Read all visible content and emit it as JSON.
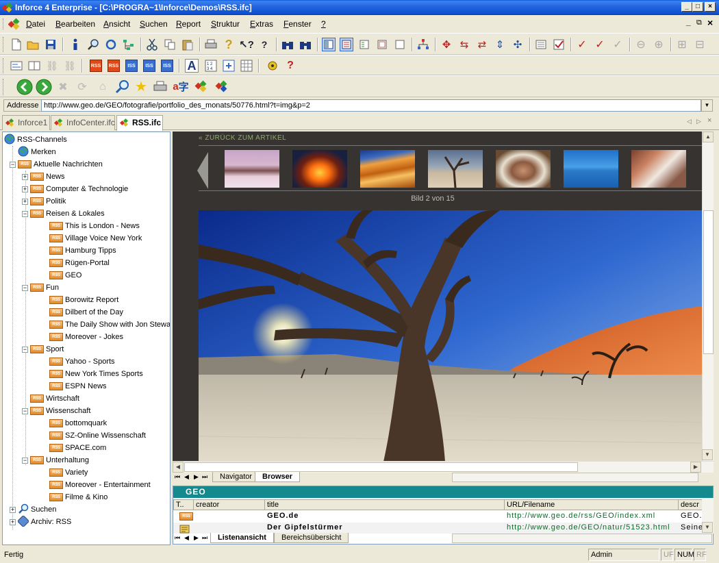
{
  "window": {
    "title": "Inforce 4 Enterprise - [C:\\PROGRA~1\\Inforce\\Demos\\RSS.ifc]",
    "min_glyph": "_",
    "max_glyph": "□",
    "close_glyph": "×",
    "mdi_min_glyph": "_",
    "mdi_restore_glyph": "⧉",
    "mdi_close_glyph": "×"
  },
  "menu": [
    "Datei",
    "Bearbeiten",
    "Ansicht",
    "Suchen",
    "Report",
    "Struktur",
    "Extras",
    "Fenster",
    "?"
  ],
  "address": {
    "label": "Addresse",
    "url": "http://www.geo.de/GEO/fotografie/portfolio_des_monats/50776.html?t=img&p=2"
  },
  "doc_tabs": [
    {
      "label": "Inforce1",
      "active": false
    },
    {
      "label": "InfoCenter.ifc",
      "active": false
    },
    {
      "label": "RSS.ifc",
      "active": true
    }
  ],
  "tree": {
    "root": "RSS-Channels",
    "items": [
      {
        "label": "Merken",
        "level": 1,
        "icon": "globe-icon"
      },
      {
        "label": "Aktuelle Nachrichten",
        "level": 1,
        "icon": "rss-folder-icon",
        "expanded": true
      },
      {
        "label": "News",
        "level": 2,
        "icon": "rss-folder-icon",
        "expanded": false
      },
      {
        "label": "Computer & Technologie",
        "level": 2,
        "icon": "rss-folder-icon",
        "expanded": false
      },
      {
        "label": "Politik",
        "level": 2,
        "icon": "rss-folder-icon",
        "expanded": false
      },
      {
        "label": "Reisen & Lokales",
        "level": 2,
        "icon": "rss-folder-icon",
        "expanded": true
      },
      {
        "label": "This is London - News",
        "level": 3,
        "icon": "rss-feed-icon"
      },
      {
        "label": "Village Voice New York",
        "level": 3,
        "icon": "rss-feed-icon"
      },
      {
        "label": "Hamburg Tipps",
        "level": 3,
        "icon": "rss-feed-icon"
      },
      {
        "label": "Rügen-Portal",
        "level": 3,
        "icon": "rss-feed-icon"
      },
      {
        "label": "GEO",
        "level": 3,
        "icon": "rss-feed-icon"
      },
      {
        "label": "Fun",
        "level": 2,
        "icon": "rss-folder-icon",
        "expanded": true
      },
      {
        "label": "Borowitz Report",
        "level": 3,
        "icon": "rss-feed-icon"
      },
      {
        "label": "Dilbert of the Day",
        "level": 3,
        "icon": "rss-feed-icon"
      },
      {
        "label": "The Daily Show with Jon Stewart",
        "level": 3,
        "icon": "rss-feed-icon"
      },
      {
        "label": "Moreover - Jokes",
        "level": 3,
        "icon": "rss-feed-icon"
      },
      {
        "label": "Sport",
        "level": 2,
        "icon": "rss-folder-icon",
        "expanded": true
      },
      {
        "label": "Yahoo - Sports",
        "level": 3,
        "icon": "rss-feed-icon"
      },
      {
        "label": "New York Times Sports",
        "level": 3,
        "icon": "rss-feed-icon"
      },
      {
        "label": "ESPN News",
        "level": 3,
        "icon": "rss-feed-icon"
      },
      {
        "label": "Wirtschaft",
        "level": 2,
        "icon": "rss-feed-icon"
      },
      {
        "label": "Wissenschaft",
        "level": 2,
        "icon": "rss-folder-icon",
        "expanded": true
      },
      {
        "label": "bottomquark",
        "level": 3,
        "icon": "rss-feed-icon"
      },
      {
        "label": "SZ-Online Wissenschaft",
        "level": 3,
        "icon": "rss-feed-icon"
      },
      {
        "label": "SPACE.com",
        "level": 3,
        "icon": "rss-feed-icon"
      },
      {
        "label": "Unterhaltung",
        "level": 2,
        "icon": "rss-folder-icon",
        "expanded": true
      },
      {
        "label": "Variety",
        "level": 3,
        "icon": "rss-feed-icon"
      },
      {
        "label": "Moreover - Entertainment",
        "level": 3,
        "icon": "rss-feed-icon"
      },
      {
        "label": "Filme & Kino",
        "level": 3,
        "icon": "rss-feed-icon"
      },
      {
        "label": "Suchen",
        "level": 1,
        "icon": "search-icon",
        "expanded": false
      },
      {
        "label": "Archiv: RSS",
        "level": 1,
        "icon": "archive-icon",
        "expanded": false
      }
    ]
  },
  "browser": {
    "back_link": "« ZURÜCK ZUM ARTIKEL",
    "counter": "Bild 2 von 15",
    "thumbnails": [
      "desert-rocks",
      "burning-crater",
      "sand-dunes",
      "dead-tree",
      "elder-portrait",
      "blue-lake",
      "rock-canyon"
    ],
    "tabs": [
      {
        "label": "Navigator",
        "active": false
      },
      {
        "label": "Browser",
        "active": true
      }
    ]
  },
  "list": {
    "header": "GEO",
    "columns": [
      "T..",
      "creator",
      "title",
      "URL/Filename",
      "descr"
    ],
    "rows": [
      {
        "title": "GEO.de",
        "url": "http://www.geo.de/rss/GEO/index.xml",
        "descr": "GEO.d"
      },
      {
        "title": "Der Gipfelstürmer",
        "url": "http://www.geo.de/GEO/natur/51523.html",
        "descr": "Seine"
      }
    ],
    "tabs": [
      {
        "label": "Listenansicht",
        "active": true
      },
      {
        "label": "Bereichsübersicht",
        "active": false
      }
    ]
  },
  "status": {
    "text": "Fertig",
    "user": "Admin",
    "uf": "UF",
    "num": "NUM",
    "rf": "RF"
  },
  "colors": {
    "titlebar": "#0d4fcf",
    "list_header": "#148a8e",
    "browser_bg": "#363330",
    "link_green": "#8fae6a"
  }
}
